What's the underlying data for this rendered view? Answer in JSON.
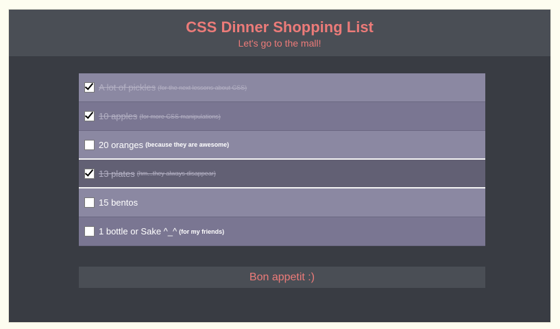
{
  "header": {
    "title": "CSS Dinner Shopping List",
    "subtitle": "Let's go to the mall!"
  },
  "items": [
    {
      "label": "A lot of pickles",
      "note": "(for the next lessons about CSS)",
      "checked": true
    },
    {
      "label": "10 apples",
      "note": "(for more CSS manipulations)",
      "checked": true
    },
    {
      "label": "20 oranges",
      "note": "(because they are awesome)",
      "checked": false
    },
    {
      "label": "13 plates",
      "note": "(hm...they always disappear)",
      "checked": true
    },
    {
      "label": "15 bentos",
      "note": "",
      "checked": false
    },
    {
      "label": "1 bottle or Sake ^_^",
      "note": "(for my friends)",
      "checked": false
    }
  ],
  "footer": {
    "text": "Bon appetit :)"
  },
  "colors": {
    "accent": "#ec7b79",
    "background": "#393c43",
    "header": "#4a4e55"
  }
}
